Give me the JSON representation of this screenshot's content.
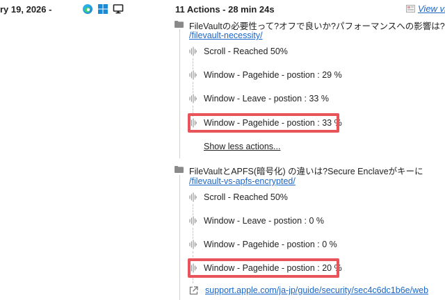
{
  "header": {
    "date_fragment": "ry 19, 2026 -",
    "env_icons": [
      "edge-icon",
      "windows-icon",
      "desktop-icon"
    ],
    "summary": "11 Actions - 28 min 24s",
    "view_link": "View vis"
  },
  "pages": [
    {
      "title": "FileVaultの必要性って?オフで良いか?パフォーマンスへの影響は?",
      "path": "/filevault-necessity/",
      "actions": [
        "Scroll - Reached 50%",
        "Window - Pagehide - postion : 29 %",
        "Window - Leave - postion : 33 %",
        "Window - Pagehide - postion : 33 %"
      ],
      "show_less": "Show less actions..."
    },
    {
      "title": "FileVaultとAPFS(暗号化) の違いは?Secure Enclaveがキーに",
      "path": "/filevault-vs-apfs-encrypted/",
      "actions": [
        "Scroll - Reached 50%",
        "Window - Leave - postion : 0 %",
        "Window - Pagehide - postion : 0 %",
        "Window - Pagehide - postion : 20 %"
      ]
    }
  ],
  "external_link": "support.apple.com/ja-jp/guide/security/sec4c6dc1b6e/web",
  "colors": {
    "link": "#1a66c8",
    "highlight": "#e8545a",
    "text": "#222222",
    "timeline": "#d0d0d0"
  }
}
